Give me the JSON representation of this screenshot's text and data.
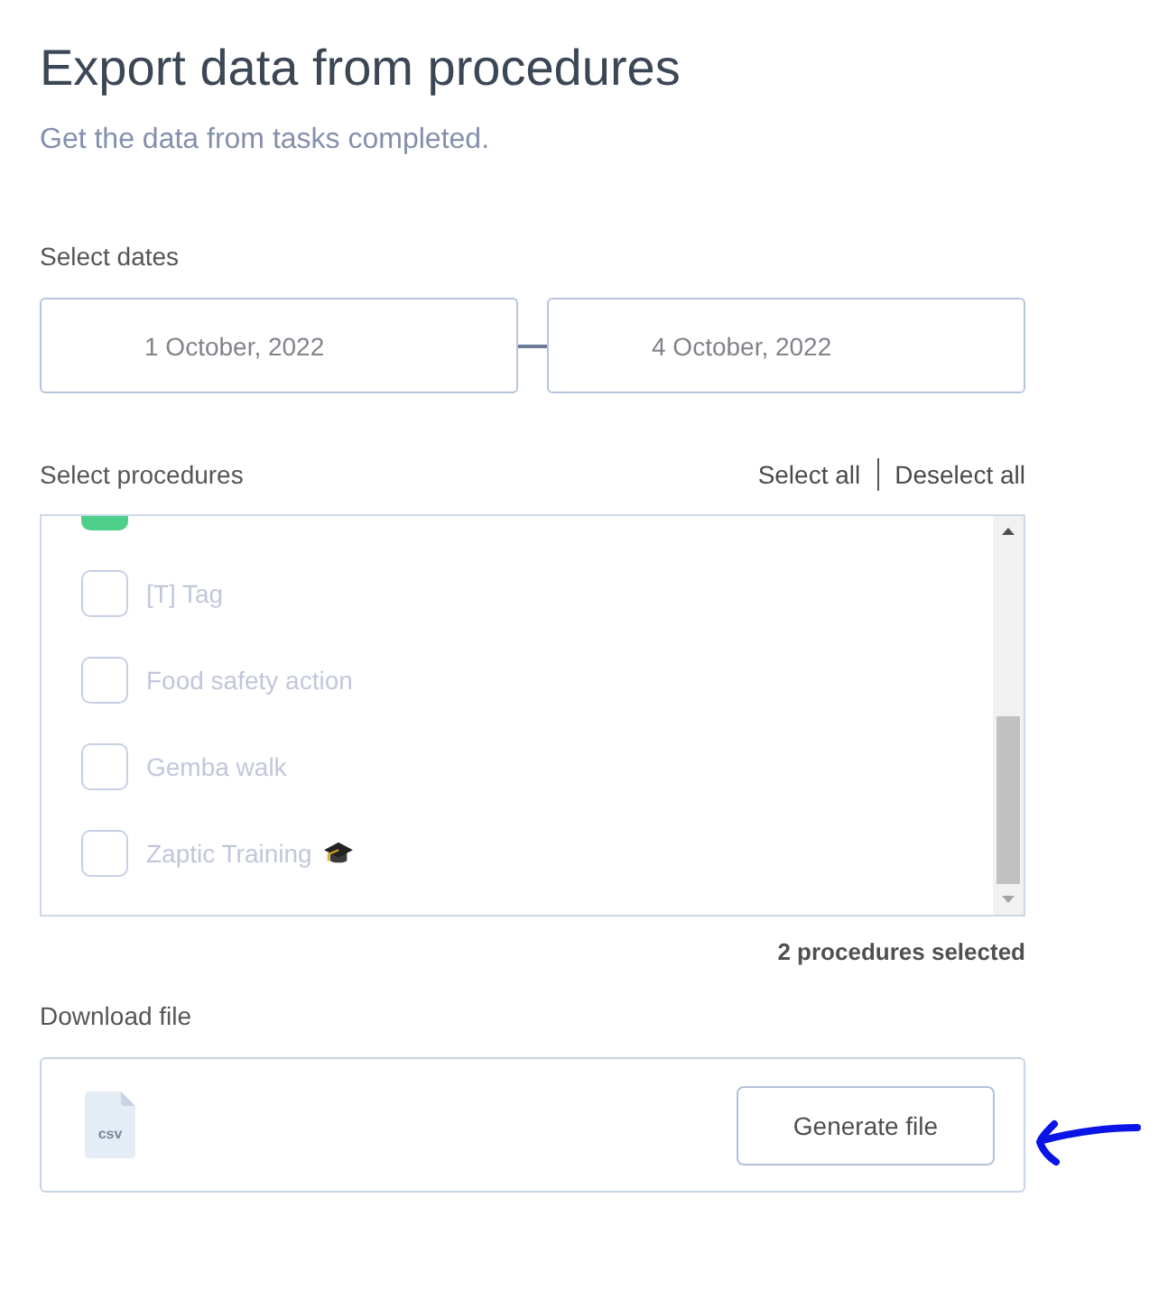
{
  "header": {
    "title": "Export data from procedures",
    "subtitle": "Get the data from tasks completed."
  },
  "dates": {
    "label": "Select dates",
    "start": "1 October, 2022",
    "end": "4 October, 2022"
  },
  "procedures": {
    "label": "Select procedures",
    "actions": [
      "Select all",
      "Deselect all"
    ],
    "items": [
      {
        "kind": "partial",
        "checked": true
      },
      {
        "kind": "row",
        "label": "[T] Tag",
        "checked": false,
        "trailing_icon": false
      },
      {
        "kind": "row",
        "label": "Food safety action",
        "checked": false,
        "trailing_icon": false
      },
      {
        "kind": "row",
        "label": "Gemba walk",
        "checked": false,
        "trailing_icon": false
      },
      {
        "kind": "row",
        "label": "Zaptic Training",
        "checked": false,
        "trailing_icon": true
      }
    ],
    "summary": "2 procedures selected"
  },
  "download": {
    "label": "Download file",
    "file_type": "csv",
    "button": "Generate file"
  },
  "annotations": [
    {
      "kind": "arrow"
    }
  ]
}
